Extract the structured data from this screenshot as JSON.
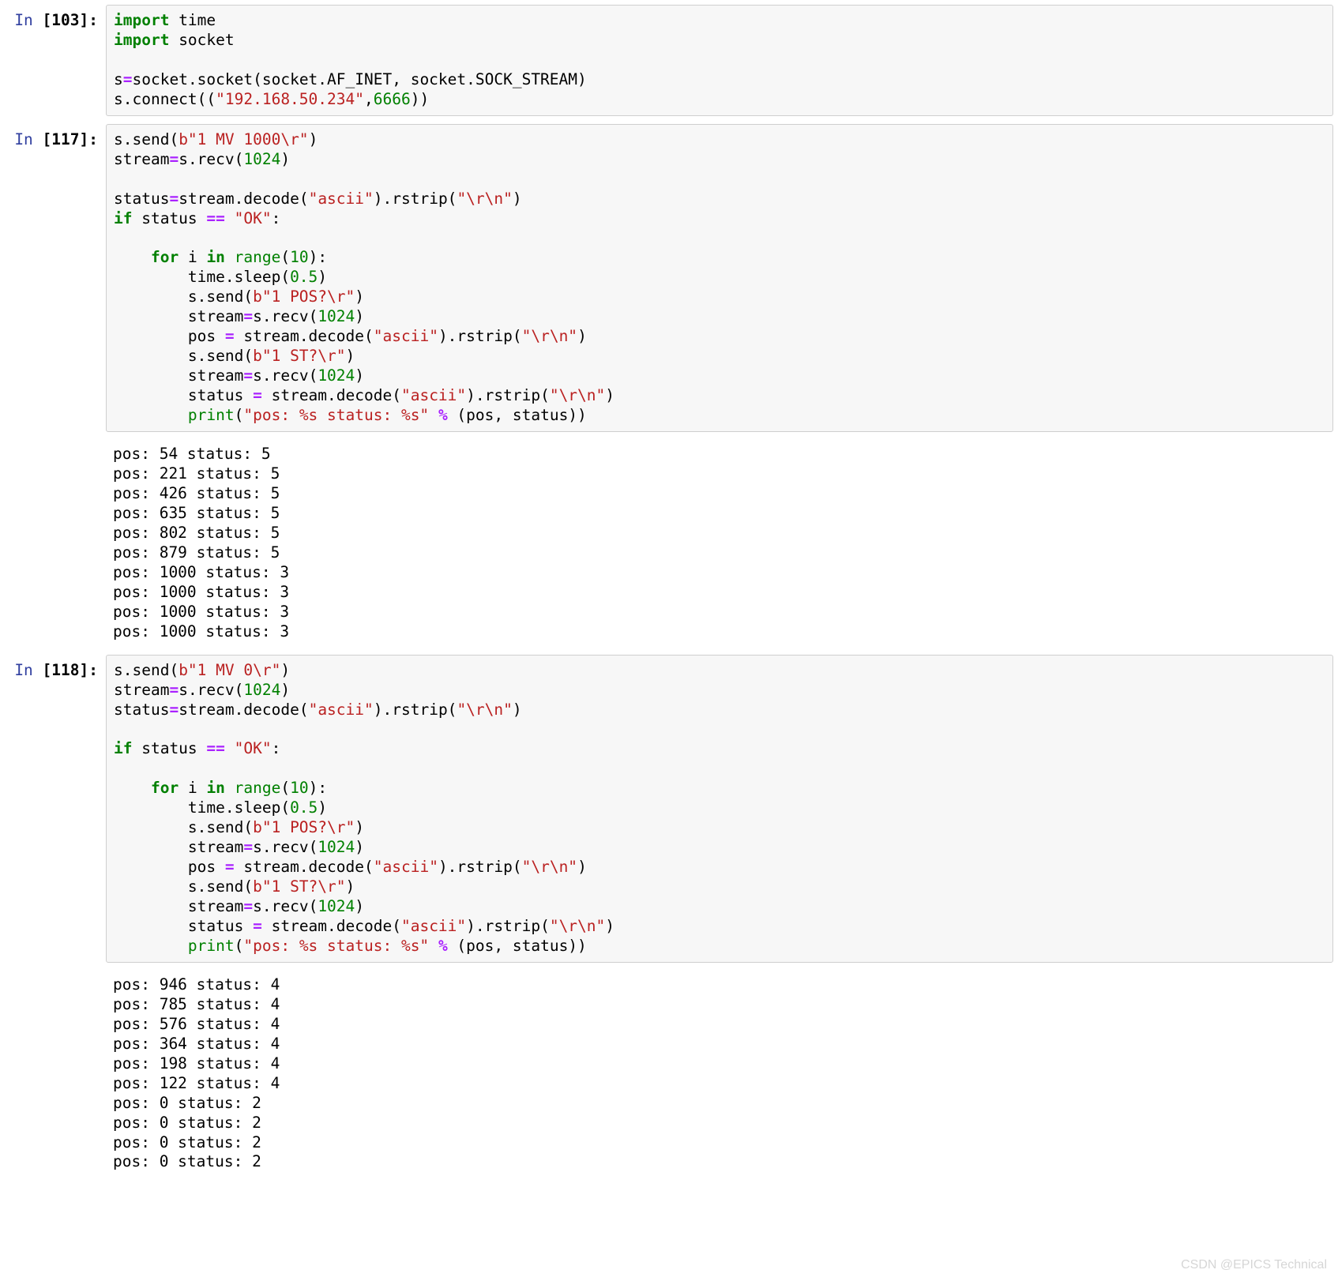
{
  "cells": [
    {
      "prompt_in": "In ",
      "prompt_num": "[103]:",
      "code_tokens": [
        [
          [
            "kw",
            "import"
          ],
          [
            "nm",
            " time"
          ]
        ],
        [
          [
            "kw",
            "import"
          ],
          [
            "nm",
            " socket"
          ]
        ],
        [],
        [
          [
            "nm",
            "s"
          ],
          [
            "op",
            "="
          ],
          [
            "nm",
            "socket.socket(socket.AF_INET, socket.SOCK_STREAM)"
          ]
        ],
        [
          [
            "nm",
            "s.connect(("
          ],
          [
            "str",
            "\"192.168.50.234\""
          ],
          [
            "nm",
            ","
          ],
          [
            "num",
            "6666"
          ],
          [
            "nm",
            "))"
          ]
        ]
      ],
      "output": ""
    },
    {
      "prompt_in": "In ",
      "prompt_num": "[117]:",
      "code_tokens": [
        [
          [
            "nm",
            "s.send("
          ],
          [
            "str",
            "b\"1 MV 1000\\r\""
          ],
          [
            "nm",
            ")"
          ]
        ],
        [
          [
            "nm",
            "stream"
          ],
          [
            "op",
            "="
          ],
          [
            "nm",
            "s.recv("
          ],
          [
            "num",
            "1024"
          ],
          [
            "nm",
            ")"
          ]
        ],
        [],
        [
          [
            "nm",
            "status"
          ],
          [
            "op",
            "="
          ],
          [
            "nm",
            "stream.decode("
          ],
          [
            "str",
            "\"ascii\""
          ],
          [
            "nm",
            ").rstrip("
          ],
          [
            "str",
            "\"\\r\\n\""
          ],
          [
            "nm",
            ")"
          ]
        ],
        [
          [
            "kw",
            "if"
          ],
          [
            "nm",
            " status "
          ],
          [
            "op",
            "=="
          ],
          [
            "nm",
            " "
          ],
          [
            "str",
            "\"OK\""
          ],
          [
            "nm",
            ":"
          ]
        ],
        [],
        [
          [
            "nm",
            "    "
          ],
          [
            "kw",
            "for"
          ],
          [
            "nm",
            " i "
          ],
          [
            "kw",
            "in"
          ],
          [
            "nm",
            " "
          ],
          [
            "bi",
            "range"
          ],
          [
            "nm",
            "("
          ],
          [
            "num",
            "10"
          ],
          [
            "nm",
            "):"
          ]
        ],
        [
          [
            "nm",
            "        time.sleep("
          ],
          [
            "num",
            "0.5"
          ],
          [
            "nm",
            ")"
          ]
        ],
        [
          [
            "nm",
            "        s.send("
          ],
          [
            "str",
            "b\"1 POS?\\r\""
          ],
          [
            "nm",
            ")"
          ]
        ],
        [
          [
            "nm",
            "        stream"
          ],
          [
            "op",
            "="
          ],
          [
            "nm",
            "s.recv("
          ],
          [
            "num",
            "1024"
          ],
          [
            "nm",
            ")"
          ]
        ],
        [
          [
            "nm",
            "        pos "
          ],
          [
            "op",
            "="
          ],
          [
            "nm",
            " stream.decode("
          ],
          [
            "str",
            "\"ascii\""
          ],
          [
            "nm",
            ").rstrip("
          ],
          [
            "str",
            "\"\\r\\n\""
          ],
          [
            "nm",
            ")"
          ]
        ],
        [
          [
            "nm",
            "        s.send("
          ],
          [
            "str",
            "b\"1 ST?\\r\""
          ],
          [
            "nm",
            ")"
          ]
        ],
        [
          [
            "nm",
            "        stream"
          ],
          [
            "op",
            "="
          ],
          [
            "nm",
            "s.recv("
          ],
          [
            "num",
            "1024"
          ],
          [
            "nm",
            ")"
          ]
        ],
        [
          [
            "nm",
            "        status "
          ],
          [
            "op",
            "="
          ],
          [
            "nm",
            " stream.decode("
          ],
          [
            "str",
            "\"ascii\""
          ],
          [
            "nm",
            ").rstrip("
          ],
          [
            "str",
            "\"\\r\\n\""
          ],
          [
            "nm",
            ")"
          ]
        ],
        [
          [
            "nm",
            "        "
          ],
          [
            "bi",
            "print"
          ],
          [
            "nm",
            "("
          ],
          [
            "str",
            "\"pos: %s status: %s\""
          ],
          [
            "nm",
            " "
          ],
          [
            "op",
            "%"
          ],
          [
            "nm",
            " (pos, status))"
          ]
        ]
      ],
      "output": "pos: 54 status: 5\npos: 221 status: 5\npos: 426 status: 5\npos: 635 status: 5\npos: 802 status: 5\npos: 879 status: 5\npos: 1000 status: 3\npos: 1000 status: 3\npos: 1000 status: 3\npos: 1000 status: 3"
    },
    {
      "prompt_in": "In ",
      "prompt_num": "[118]:",
      "code_tokens": [
        [
          [
            "nm",
            "s.send("
          ],
          [
            "str",
            "b\"1 MV 0\\r\""
          ],
          [
            "nm",
            ")"
          ]
        ],
        [
          [
            "nm",
            "stream"
          ],
          [
            "op",
            "="
          ],
          [
            "nm",
            "s.recv("
          ],
          [
            "num",
            "1024"
          ],
          [
            "nm",
            ")"
          ]
        ],
        [
          [
            "nm",
            "status"
          ],
          [
            "op",
            "="
          ],
          [
            "nm",
            "stream.decode("
          ],
          [
            "str",
            "\"ascii\""
          ],
          [
            "nm",
            ").rstrip("
          ],
          [
            "str",
            "\"\\r\\n\""
          ],
          [
            "nm",
            ")"
          ]
        ],
        [],
        [
          [
            "kw",
            "if"
          ],
          [
            "nm",
            " status "
          ],
          [
            "op",
            "=="
          ],
          [
            "nm",
            " "
          ],
          [
            "str",
            "\"OK\""
          ],
          [
            "nm",
            ":"
          ]
        ],
        [],
        [
          [
            "nm",
            "    "
          ],
          [
            "kw",
            "for"
          ],
          [
            "nm",
            " i "
          ],
          [
            "kw",
            "in"
          ],
          [
            "nm",
            " "
          ],
          [
            "bi",
            "range"
          ],
          [
            "nm",
            "("
          ],
          [
            "num",
            "10"
          ],
          [
            "nm",
            "):"
          ]
        ],
        [
          [
            "nm",
            "        time.sleep("
          ],
          [
            "num",
            "0.5"
          ],
          [
            "nm",
            ")"
          ]
        ],
        [
          [
            "nm",
            "        s.send("
          ],
          [
            "str",
            "b\"1 POS?\\r\""
          ],
          [
            "nm",
            ")"
          ]
        ],
        [
          [
            "nm",
            "        stream"
          ],
          [
            "op",
            "="
          ],
          [
            "nm",
            "s.recv("
          ],
          [
            "num",
            "1024"
          ],
          [
            "nm",
            ")"
          ]
        ],
        [
          [
            "nm",
            "        pos "
          ],
          [
            "op",
            "="
          ],
          [
            "nm",
            " stream.decode("
          ],
          [
            "str",
            "\"ascii\""
          ],
          [
            "nm",
            ").rstrip("
          ],
          [
            "str",
            "\"\\r\\n\""
          ],
          [
            "nm",
            ")"
          ]
        ],
        [
          [
            "nm",
            "        s.send("
          ],
          [
            "str",
            "b\"1 ST?\\r\""
          ],
          [
            "nm",
            ")"
          ]
        ],
        [
          [
            "nm",
            "        stream"
          ],
          [
            "op",
            "="
          ],
          [
            "nm",
            "s.recv("
          ],
          [
            "num",
            "1024"
          ],
          [
            "nm",
            ")"
          ]
        ],
        [
          [
            "nm",
            "        status "
          ],
          [
            "op",
            "="
          ],
          [
            "nm",
            " stream.decode("
          ],
          [
            "str",
            "\"ascii\""
          ],
          [
            "nm",
            ").rstrip("
          ],
          [
            "str",
            "\"\\r\\n\""
          ],
          [
            "nm",
            ")"
          ]
        ],
        [
          [
            "nm",
            "        "
          ],
          [
            "bi",
            "print"
          ],
          [
            "nm",
            "("
          ],
          [
            "str",
            "\"pos: %s status: %s\""
          ],
          [
            "nm",
            " "
          ],
          [
            "op",
            "%"
          ],
          [
            "nm",
            " (pos, status))"
          ]
        ]
      ],
      "output": "pos: 946 status: 4\npos: 785 status: 4\npos: 576 status: 4\npos: 364 status: 4\npos: 198 status: 4\npos: 122 status: 4\npos: 0 status: 2\npos: 0 status: 2\npos: 0 status: 2\npos: 0 status: 2"
    }
  ],
  "watermark": "CSDN @EPICS Technical"
}
